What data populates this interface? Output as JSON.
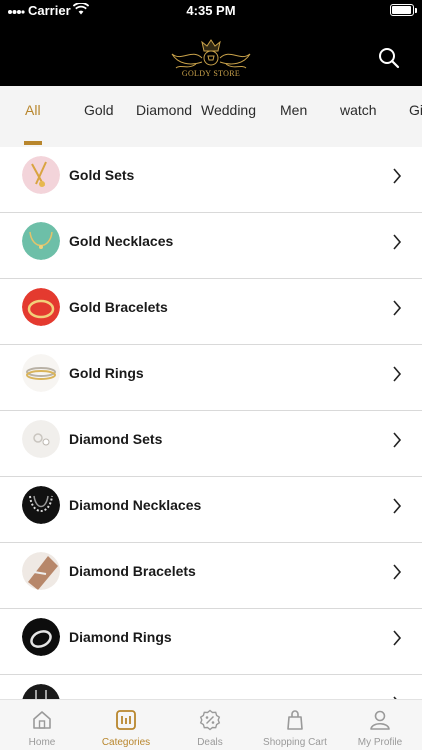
{
  "status_bar": {
    "carrier": "Carrier",
    "time": "4:35 PM",
    "battery_level": 0.95
  },
  "header": {
    "logo_text": "GOLDY STORE"
  },
  "tabs": [
    {
      "label": "All",
      "active": true
    },
    {
      "label": "Gold"
    },
    {
      "label": "Diamond"
    },
    {
      "label": "Wedding"
    },
    {
      "label": "Men"
    },
    {
      "label": "watch"
    },
    {
      "label": "Gi"
    }
  ],
  "categories": [
    {
      "label": "Gold Sets",
      "icon": "gold-sets-thumb"
    },
    {
      "label": "Gold Necklaces",
      "icon": "gold-necklaces-thumb"
    },
    {
      "label": "Gold Bracelets",
      "icon": "gold-bracelets-thumb"
    },
    {
      "label": "Gold Rings",
      "icon": "gold-rings-thumb"
    },
    {
      "label": "Diamond Sets",
      "icon": "diamond-sets-thumb"
    },
    {
      "label": "Diamond Necklaces",
      "icon": "diamond-necklaces-thumb"
    },
    {
      "label": "Diamond Bracelets",
      "icon": "diamond-bracelets-thumb"
    },
    {
      "label": "Diamond Rings",
      "icon": "diamond-rings-thumb"
    }
  ],
  "bottom_nav": [
    {
      "label": "Home",
      "icon": "home-icon"
    },
    {
      "label": "Categories",
      "icon": "categories-icon",
      "active": true
    },
    {
      "label": "Deals",
      "icon": "deals-icon"
    },
    {
      "label": "Shopping Cart",
      "icon": "cart-icon"
    },
    {
      "label": "My Profile",
      "icon": "profile-icon"
    }
  ],
  "colors": {
    "accent": "#b8862d",
    "header_bg": "#000000",
    "tab_bg": "#f4f4f4"
  }
}
